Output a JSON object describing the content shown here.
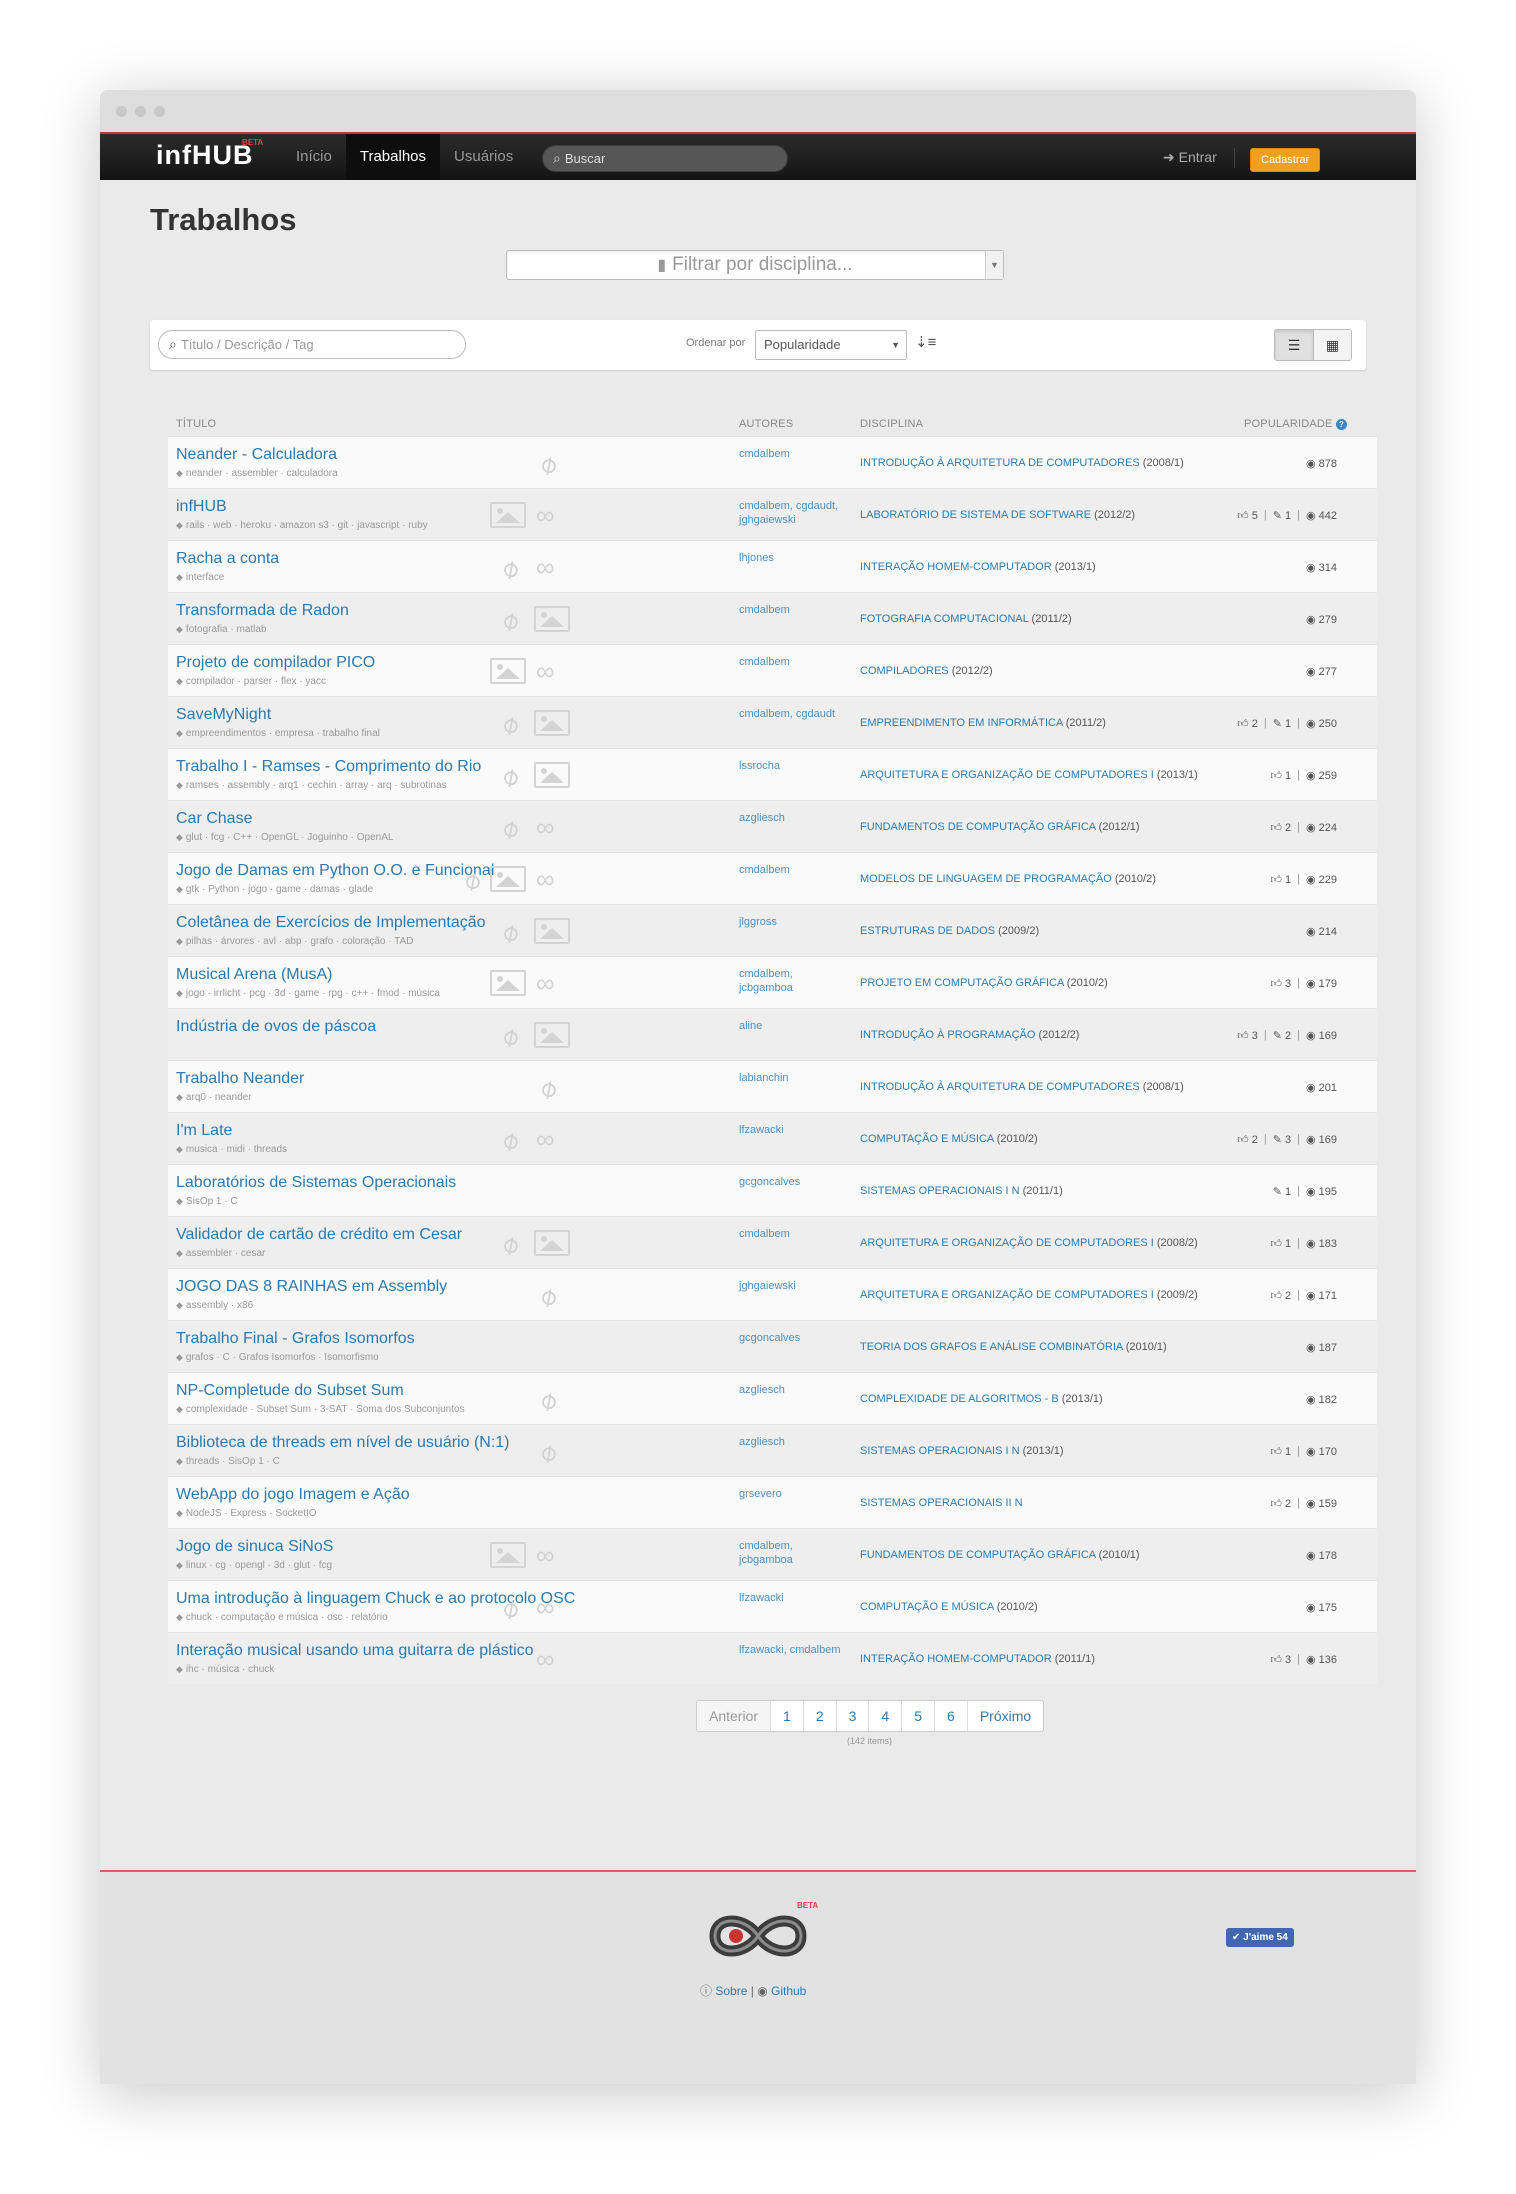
{
  "nav": {
    "brand": "infHUB",
    "brand_badge": "BETA",
    "items": [
      {
        "label": "Início"
      },
      {
        "label": "Trabalhos"
      },
      {
        "label": "Usuários"
      }
    ],
    "search_placeholder": "Buscar",
    "login": "Entrar",
    "signup": "Cadastrar"
  },
  "page": {
    "title": "Trabalhos",
    "filter_placeholder": "Filtrar por disciplina..."
  },
  "toolbar": {
    "search_placeholder": "Título / Descrição / Tag",
    "sort_label": "Ordenar por",
    "sort_value": "Popularidade"
  },
  "columns": {
    "title": "Título",
    "authors": "Autores",
    "discipline": "Disciplina",
    "popularity": "Popularidade"
  },
  "works": [
    {
      "title": "Neander - Calculadora",
      "tags": "neander · assembler · calculadora",
      "has_image": false,
      "has_link": false,
      "has_attach": true,
      "authors": "cmdalbem",
      "discipline": "INTRODUÇÃO À ARQUITETURA DE COMPUTADORES",
      "semester": "(2008/1)",
      "likes": "",
      "comments": "",
      "views": "878"
    },
    {
      "title": "infHUB",
      "tags": "rails · web · heroku · amazon s3 · git · javascript · ruby",
      "has_image": true,
      "has_link": true,
      "has_attach": false,
      "authors": "cmdalbem, cgdaudt, jghgaiewski",
      "discipline": "LABORATÓRIO DE SISTEMA DE SOFTWARE",
      "semester": "(2012/2)",
      "likes": "5",
      "comments": "1",
      "views": "442"
    },
    {
      "title": "Racha a conta",
      "tags": "interface",
      "has_image": false,
      "has_link": true,
      "has_attach": true,
      "authors": "lhjones",
      "discipline": "INTERAÇÃO HOMEM-COMPUTADOR",
      "semester": "(2013/1)",
      "likes": "",
      "comments": "",
      "views": "314"
    },
    {
      "title": "Transformada de Radon",
      "tags": "fotografia · matlab",
      "has_image": true,
      "has_link": false,
      "has_attach": true,
      "authors": "cmdalbem",
      "discipline": "FOTOGRAFIA COMPUTACIONAL",
      "semester": "(2011/2)",
      "likes": "",
      "comments": "",
      "views": "279"
    },
    {
      "title": "Projeto de compilador PICO",
      "tags": "compilador · parser · flex · yacc",
      "has_image": true,
      "has_link": true,
      "has_attach": false,
      "authors": "cmdalbem",
      "discipline": "COMPILADORES",
      "semester": "(2012/2)",
      "likes": "",
      "comments": "",
      "views": "277"
    },
    {
      "title": "SaveMyNight",
      "tags": "empreendimentos · empresa · trabalho final",
      "has_image": true,
      "has_link": false,
      "has_attach": true,
      "authors": "cmdalbem, cgdaudt",
      "discipline": "EMPREENDIMENTO EM INFORMÁTICA",
      "semester": "(2011/2)",
      "likes": "2",
      "comments": "1",
      "views": "250"
    },
    {
      "title": "Trabalho I - Ramses - Comprimento do Rio",
      "tags": "ramses · assembly · arq1 · cechin · array · arq · subrotinas",
      "has_image": true,
      "has_link": false,
      "has_attach": true,
      "authors": "lssrocha",
      "discipline": "ARQUITETURA E ORGANIZAÇÃO DE COMPUTADORES I",
      "semester": "(2013/1)",
      "likes": "1",
      "comments": "",
      "views": "259"
    },
    {
      "title": "Car Chase",
      "tags": "glut · fcg · C++ · OpenGL · Joguinho · OpenAL",
      "has_image": false,
      "has_link": true,
      "has_attach": true,
      "authors": "azgliesch",
      "discipline": "FUNDAMENTOS DE COMPUTAÇÃO GRÁFICA",
      "semester": "(2012/1)",
      "likes": "2",
      "comments": "",
      "views": "224"
    },
    {
      "title": "Jogo de Damas em Python O.O. e Funcional",
      "tags": "gtk · Python · jogo · game · damas · glade",
      "has_image": true,
      "has_link": true,
      "has_attach": true,
      "authors": "cmdalbem",
      "discipline": "MODELOS DE LINGUAGEM DE PROGRAMAÇÃO",
      "semester": "(2010/2)",
      "likes": "1",
      "comments": "",
      "views": "229"
    },
    {
      "title": "Coletânea de Exercícios de Implementação",
      "tags": "pilhas · árvores · avl · abp · grafo · coloração · TAD",
      "has_image": true,
      "has_link": false,
      "has_attach": true,
      "authors": "jlggross",
      "discipline": "ESTRUTURAS DE DADOS",
      "semester": "(2009/2)",
      "likes": "",
      "comments": "",
      "views": "214"
    },
    {
      "title": "Musical Arena (MusA)",
      "tags": "jogo · irrlicht · pcg · 3d · game · rpg · c++ · fmod · música",
      "has_image": true,
      "has_link": true,
      "has_attach": false,
      "authors": "cmdalbem, jcbgamboa",
      "discipline": "PROJETO EM COMPUTAÇÃO GRÁFICA",
      "semester": "(2010/2)",
      "likes": "3",
      "comments": "",
      "views": "179"
    },
    {
      "title": "Indústria de ovos de páscoa",
      "tags": "",
      "has_image": true,
      "has_link": false,
      "has_attach": true,
      "authors": "aline",
      "discipline": "INTRODUÇÃO À PROGRAMAÇÃO",
      "semester": "(2012/2)",
      "likes": "3",
      "comments": "2",
      "views": "169"
    },
    {
      "title": "Trabalho Neander",
      "tags": "arq0 · neander",
      "has_image": false,
      "has_link": false,
      "has_attach": true,
      "authors": "labianchin",
      "discipline": "INTRODUÇÃO À ARQUITETURA DE COMPUTADORES",
      "semester": "(2008/1)",
      "likes": "",
      "comments": "",
      "views": "201"
    },
    {
      "title": "I'm Late",
      "tags": "musica · midi · threads",
      "has_image": false,
      "has_link": true,
      "has_attach": true,
      "authors": "lfzawacki",
      "discipline": "COMPUTAÇÃO E MÚSICA",
      "semester": "(2010/2)",
      "likes": "2",
      "comments": "3",
      "views": "169"
    },
    {
      "title": "Laboratórios de Sistemas Operacionais",
      "tags": "SisOp 1 · C",
      "has_image": false,
      "has_link": false,
      "has_attach": false,
      "authors": "gcgoncalves",
      "discipline": "SISTEMAS OPERACIONAIS I N",
      "semester": "(2011/1)",
      "likes": "",
      "comments": "1",
      "views": "195"
    },
    {
      "title": "Validador de cartão de crédito em Cesar",
      "tags": "assembler · cesar",
      "has_image": true,
      "has_link": false,
      "has_attach": true,
      "authors": "cmdalbem",
      "discipline": "ARQUITETURA E ORGANIZAÇÃO DE COMPUTADORES I",
      "semester": "(2008/2)",
      "likes": "1",
      "comments": "",
      "views": "183"
    },
    {
      "title": "JOGO DAS 8 RAINHAS em Assembly",
      "tags": "assembly · x86",
      "has_image": false,
      "has_link": false,
      "has_attach": true,
      "authors": "jghgaiewski",
      "discipline": "ARQUITETURA E ORGANIZAÇÃO DE COMPUTADORES I",
      "semester": "(2009/2)",
      "likes": "2",
      "comments": "",
      "views": "171"
    },
    {
      "title": "Trabalho Final - Grafos Isomorfos",
      "tags": "grafos · C · Grafos Isomorfos · Isomorfismo",
      "has_image": false,
      "has_link": false,
      "has_attach": false,
      "authors": "gcgoncalves",
      "discipline": "TEORIA DOS GRAFOS E ANÁLISE COMBINATÓRIA",
      "semester": "(2010/1)",
      "likes": "",
      "comments": "",
      "views": "187"
    },
    {
      "title": "NP-Completude do Subset Sum",
      "tags": "complexidade · Subset Sum · 3-SAT · Soma dos Subconjuntos",
      "has_image": false,
      "has_link": false,
      "has_attach": true,
      "authors": "azgliesch",
      "discipline": "COMPLEXIDADE DE ALGORITMOS - B",
      "semester": "(2013/1)",
      "likes": "",
      "comments": "",
      "views": "182"
    },
    {
      "title": "Biblioteca de threads em nível de usuário (N:1)",
      "tags": "threads · SisOp 1 · C",
      "has_image": false,
      "has_link": false,
      "has_attach": true,
      "authors": "azgliesch",
      "discipline": "SISTEMAS OPERACIONAIS I N",
      "semester": "(2013/1)",
      "likes": "1",
      "comments": "",
      "views": "170"
    },
    {
      "title": "WebApp do jogo Imagem e Ação",
      "tags": "NodeJS · Express · SocketIO",
      "has_image": false,
      "has_link": false,
      "has_attach": false,
      "authors": "grsevero",
      "discipline": "SISTEMAS OPERACIONAIS II N",
      "semester": "",
      "likes": "2",
      "comments": "",
      "views": "159"
    },
    {
      "title": "Jogo de sinuca SiNoS",
      "tags": "linux · cg · opengl · 3d · glut · fcg",
      "has_image": true,
      "has_link": true,
      "has_attach": false,
      "authors": "cmdalbem, jcbgamboa",
      "discipline": "FUNDAMENTOS DE COMPUTAÇÃO GRÁFICA",
      "semester": "(2010/1)",
      "likes": "",
      "comments": "",
      "views": "178"
    },
    {
      "title": "Uma introdução à linguagem Chuck e ao protocolo OSC",
      "tags": "chuck · computação e música · osc · relatório",
      "has_image": false,
      "has_link": true,
      "has_attach": true,
      "authors": "lfzawacki",
      "discipline": "COMPUTAÇÃO E MÚSICA",
      "semester": "(2010/2)",
      "likes": "",
      "comments": "",
      "views": "175"
    },
    {
      "title": "Interação musical usando uma guitarra de plástico",
      "tags": "ihc · música · chuck",
      "has_image": false,
      "has_link": true,
      "has_attach": false,
      "authors": "lfzawacki, cmdalbem",
      "discipline": "INTERAÇÃO HOMEM-COMPUTADOR",
      "semester": "(2011/1)",
      "likes": "3",
      "comments": "",
      "views": "136"
    }
  ],
  "pagination": {
    "prev": "Anterior",
    "pages": [
      "1",
      "2",
      "3",
      "4",
      "5",
      "6"
    ],
    "next": "Próximo",
    "count": "(142 items)"
  },
  "footer": {
    "beta": "BETA",
    "about": "Sobre",
    "github": "Github",
    "separator": "|",
    "like": "J'aime 54"
  }
}
